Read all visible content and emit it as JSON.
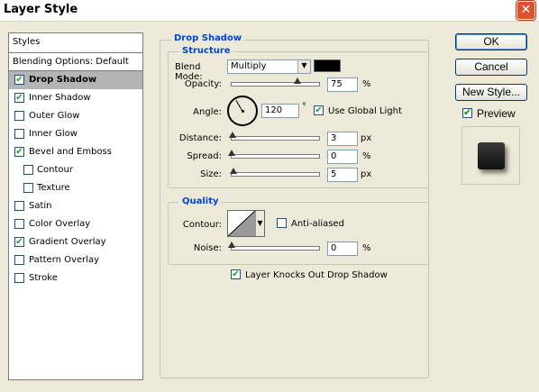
{
  "window": {
    "title": "Layer Style",
    "close_label": "✕"
  },
  "styles": {
    "header": "Styles",
    "blending_options": "Blending Options: Default",
    "items": [
      {
        "label": "Drop Shadow",
        "checked": true,
        "selected": true,
        "sub": false
      },
      {
        "label": "Inner Shadow",
        "checked": true,
        "selected": false,
        "sub": false
      },
      {
        "label": "Outer Glow",
        "checked": false,
        "selected": false,
        "sub": false
      },
      {
        "label": "Inner Glow",
        "checked": false,
        "selected": false,
        "sub": false
      },
      {
        "label": "Bevel and Emboss",
        "checked": true,
        "selected": false,
        "sub": false
      },
      {
        "label": "Contour",
        "checked": false,
        "selected": false,
        "sub": true
      },
      {
        "label": "Texture",
        "checked": false,
        "selected": false,
        "sub": true
      },
      {
        "label": "Satin",
        "checked": false,
        "selected": false,
        "sub": false
      },
      {
        "label": "Color Overlay",
        "checked": false,
        "selected": false,
        "sub": false
      },
      {
        "label": "Gradient Overlay",
        "checked": true,
        "selected": false,
        "sub": false
      },
      {
        "label": "Pattern Overlay",
        "checked": false,
        "selected": false,
        "sub": false
      },
      {
        "label": "Stroke",
        "checked": false,
        "selected": false,
        "sub": false
      }
    ]
  },
  "drop_shadow": {
    "title": "Drop Shadow",
    "structure_title": "Structure",
    "blend_mode_label": "Blend Mode:",
    "blend_mode_value": "Multiply",
    "shadow_color": "#000000",
    "opacity_label": "Opacity:",
    "opacity_value": "75",
    "opacity_unit": "%",
    "opacity_level": 0.75,
    "angle_label": "Angle:",
    "angle_value": "120",
    "angle_unit": "°",
    "use_global_light_label": "Use Global Light",
    "use_global_light": true,
    "distance_label": "Distance:",
    "distance_value": "3",
    "distance_unit": "px",
    "distance_level": 0.01,
    "spread_label": "Spread:",
    "spread_value": "0",
    "spread_unit": "%",
    "spread_level": 0.0,
    "size_label": "Size:",
    "size_value": "5",
    "size_unit": "px",
    "size_level": 0.02
  },
  "quality": {
    "title": "Quality",
    "contour_label": "Contour:",
    "anti_aliased_label": "Anti-aliased",
    "anti_aliased": false,
    "noise_label": "Noise:",
    "noise_value": "0",
    "noise_unit": "%",
    "noise_level": 0.0
  },
  "knockout": {
    "label": "Layer Knocks Out Drop Shadow",
    "checked": true
  },
  "buttons": {
    "ok": "OK",
    "cancel": "Cancel",
    "new_style": "New Style..."
  },
  "preview": {
    "label": "Preview",
    "checked": true
  }
}
